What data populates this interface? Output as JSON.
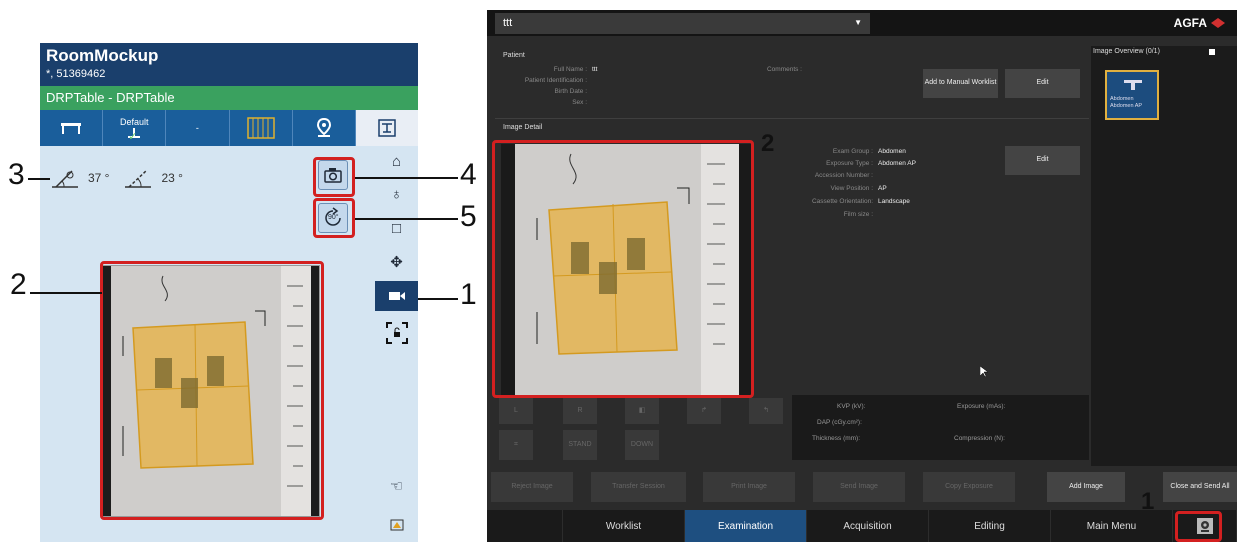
{
  "tablet": {
    "title": "RoomMockup",
    "subtitle": "*, 51369462",
    "table_name": "DRPTable - DRPTable",
    "toolbar": {
      "default_label": "Default",
      "dash_label": "-"
    },
    "angles": {
      "first": "37 °",
      "second": "23 °"
    },
    "rotate_label": "90°"
  },
  "callouts": {
    "c1": "1",
    "c2": "2",
    "c3": "3",
    "c4": "4",
    "c5": "5"
  },
  "desktop": {
    "patient_select": "ttt",
    "brand": "AGFA",
    "patient_section": "Patient",
    "patient": {
      "full_name_label": "Full Name :",
      "full_name": "ttt",
      "id_label": "Patient Identification :",
      "birth_label": "Birth Date :",
      "sex_label": "Sex :",
      "comments_label": "Comments :"
    },
    "add_worklist": "Add to Manual Worklist",
    "edit": "Edit",
    "detail_section": "Image Detail",
    "detail": {
      "exam_group_label": "Exam Group :",
      "exam_group": "Abdomen",
      "exposure_type_label": "Exposure Type :",
      "exposure_type": "Abdomen AP",
      "accession_label": "Accession Number :",
      "view_label": "View Position :",
      "view": "AP",
      "cassette_label": "Cassette Orientation:",
      "cassette": "Landscape",
      "film_label": "Film size :"
    },
    "overview_title": "Image Overview (0/1)",
    "thumb": {
      "line1": "Abdomen",
      "line2": "Abdomen AP"
    },
    "tools": {
      "l": "L",
      "r": "R",
      "stand": "STAND",
      "down": "DOWN"
    },
    "kvp": {
      "kvp": "KVP (kV):",
      "exposure": "Exposure (mAs):",
      "dap": "DAP (cGy.cm²):",
      "thickness": "Thickness (mm):",
      "compression": "Compression (N):"
    },
    "actions": {
      "reject": "Reject Image",
      "transfer": "Transfer Session",
      "print": "Print Image",
      "send": "Send Image",
      "copy": "Copy Exposure",
      "add": "Add Image",
      "close_send": "Close and Send All"
    },
    "nav": [
      "Worklist",
      "Examination",
      "Acquisition",
      "Editing",
      "Main Menu"
    ]
  }
}
